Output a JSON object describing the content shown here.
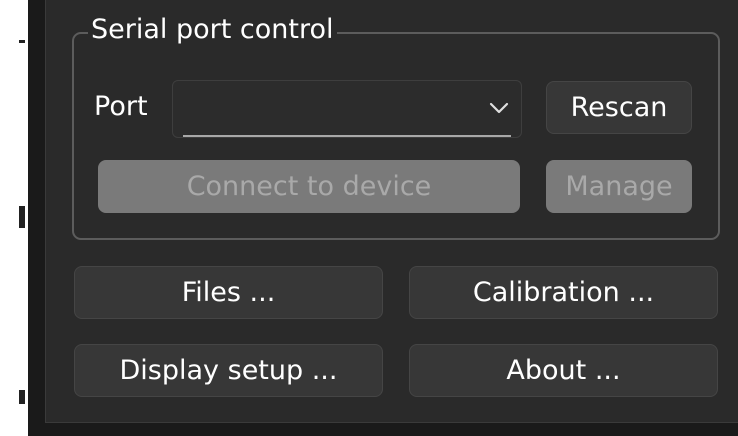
{
  "serial_group": {
    "title": "Serial port control",
    "port_label": "Port",
    "port_selected": "",
    "rescan_label": "Rescan",
    "connect_label": "Connect to device",
    "manage_label": "Manage"
  },
  "buttons": {
    "files_label": "Files ...",
    "calibration_label": "Calibration ...",
    "display_setup_label": "Display setup ...",
    "about_label": "About ..."
  },
  "icons": {
    "dropdown": "chevron-down-icon"
  },
  "colors": {
    "panel_background": "#2a2a2a",
    "button_background": "#373737",
    "disabled_button_background": "#7a7a7a",
    "disabled_text": "#a9a9a9",
    "text": "#ffffff"
  }
}
